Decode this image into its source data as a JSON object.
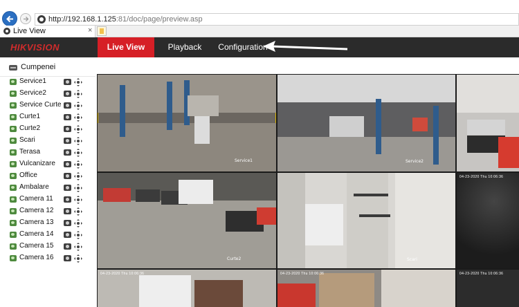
{
  "browser": {
    "url_main": "http://192.168.1.125",
    "url_rest": ":81/doc/page/preview.asp",
    "tab_title": "Live View",
    "tab_close": "×"
  },
  "nav": {
    "logo": "HIKVISION",
    "items": [
      {
        "label": "Live View",
        "active": true
      },
      {
        "label": "Playback",
        "active": false
      },
      {
        "label": "Configuration",
        "active": false
      }
    ]
  },
  "sidebar": {
    "device": "Cumpenei",
    "cameras": [
      "Service1",
      "Service2",
      "Service Curte",
      "Curte1",
      "Curte2",
      "Scari",
      "Terasa",
      "Vulcanizare",
      "Office",
      "Ambalare",
      "Camera 11",
      "Camera 12",
      "Camera 13",
      "Camera 14",
      "Camera 15",
      "Camera 16"
    ]
  },
  "grid": {
    "labels": {
      "cell1": "Service1",
      "cell2": "Service2",
      "cell4": "Curte2",
      "cell5": "Scari"
    },
    "timestamp": "04-23-2020 Thu 10:06:36"
  },
  "colors": {
    "accent": "#d61f26",
    "navbar": "#2b2b2b",
    "selected_border": "#d9b400"
  }
}
